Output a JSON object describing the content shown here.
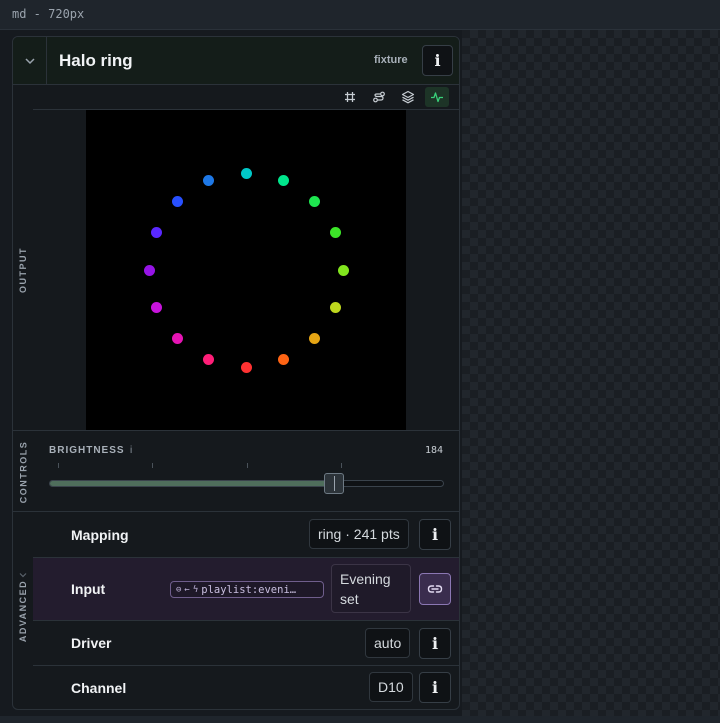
{
  "window": {
    "label": "md - 720px"
  },
  "panel": {
    "title": "Halo ring",
    "tag": "fixture",
    "info_glyph": "i",
    "collapse_icon": "chevron-down-icon"
  },
  "output": {
    "section_label": "OUTPUT",
    "tools": [
      {
        "name": "grid-icon",
        "active": false
      },
      {
        "name": "route-icon",
        "active": false
      },
      {
        "name": "layers-icon",
        "active": false
      },
      {
        "name": "activity-icon",
        "active": true
      }
    ],
    "accent_color": "#39d27a",
    "led_colors": [
      "#00c8c8",
      "#00e68c",
      "#1ee650",
      "#3ce628",
      "#82e61e",
      "#bed71e",
      "#e6a514",
      "#ff6414",
      "#ff3232",
      "#ff1e78",
      "#e614b4",
      "#c814dc",
      "#9614e6",
      "#5a28ff",
      "#2850ff",
      "#1e78e6"
    ]
  },
  "controls": {
    "section_label": "CONTROLS",
    "brightness": {
      "label": "BRIGHTNESS",
      "info_glyph": "i",
      "value": "184",
      "max": 255
    }
  },
  "advanced": {
    "section_label": "ADVANCED",
    "rows": {
      "mapping": {
        "label": "Mapping",
        "value": "ring · 241 pts"
      },
      "input": {
        "label": "Input",
        "binding_text": "playlist:eveni…",
        "value_line1": "Evening",
        "value_line2": "set"
      },
      "driver": {
        "label": "Driver",
        "value": "auto"
      },
      "channel": {
        "label": "Channel",
        "value": "D10"
      }
    }
  }
}
